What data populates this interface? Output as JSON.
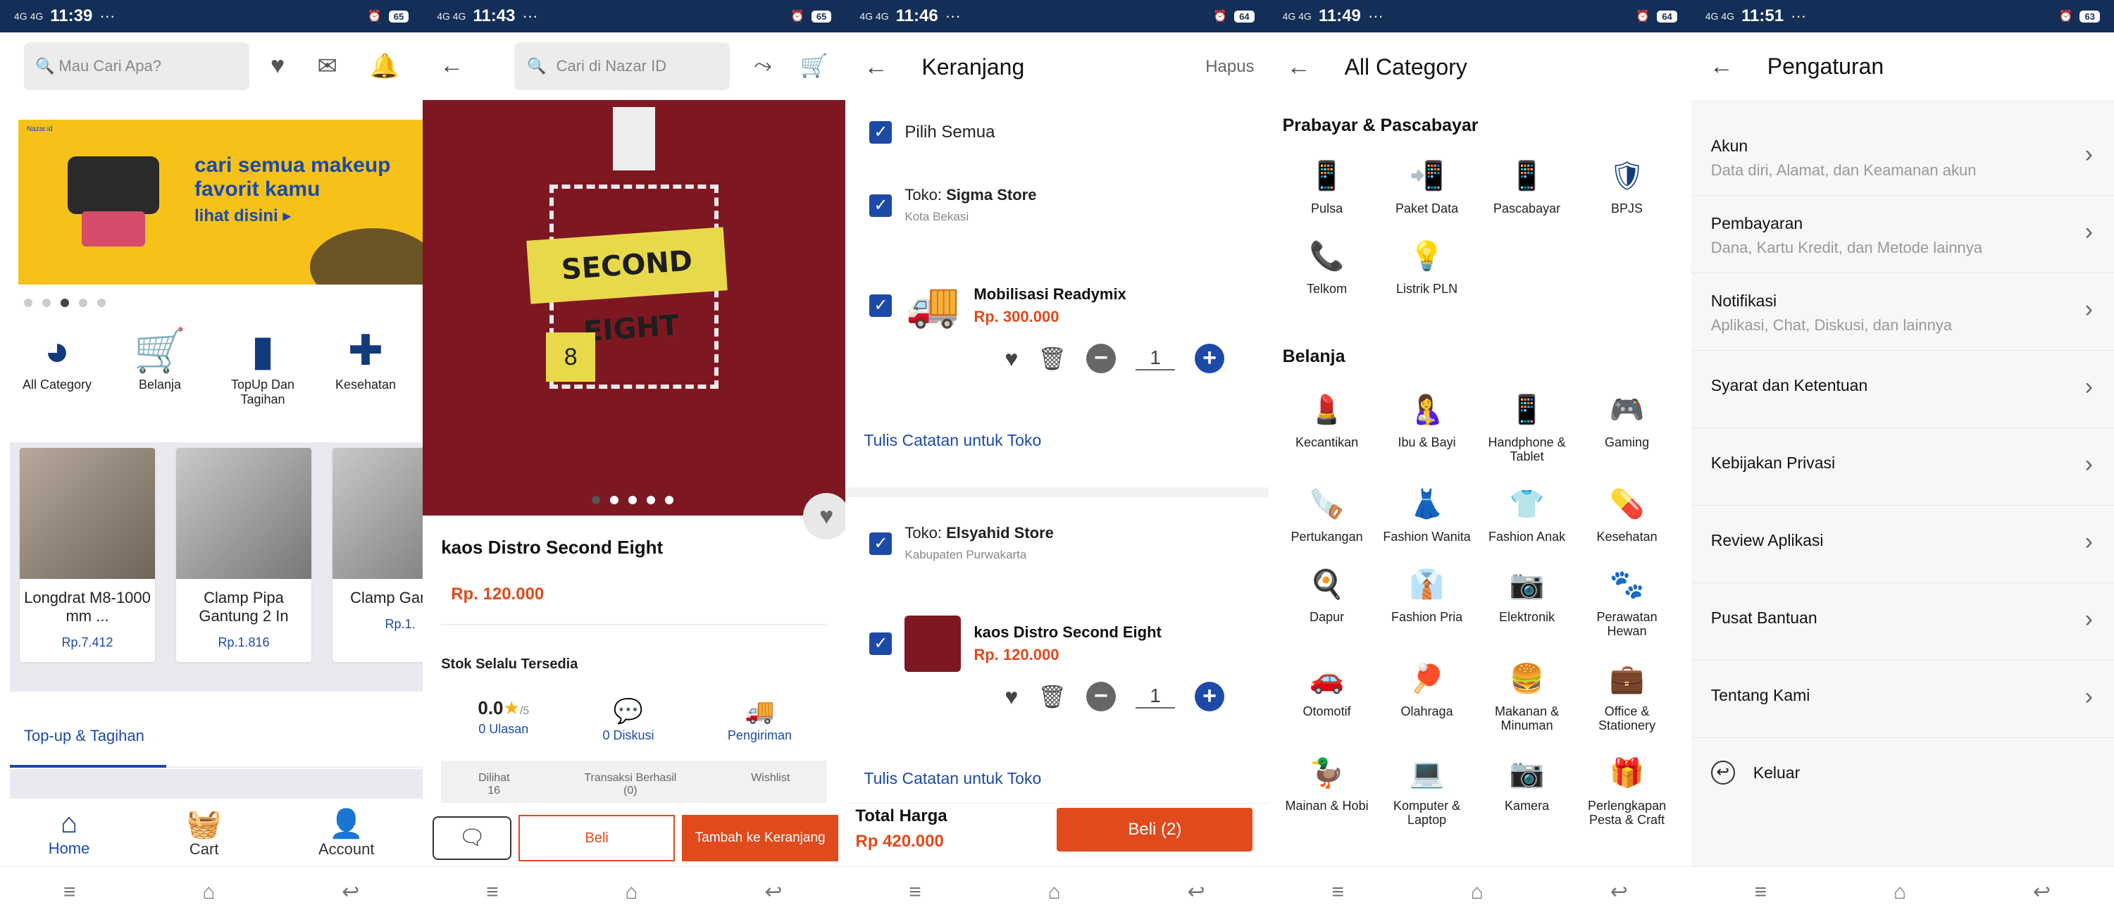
{
  "status_bars": [
    {
      "net": "4G 4G",
      "time": "11:39",
      "battery": "65"
    },
    {
      "net": "4G 4G",
      "time": "11:43",
      "battery": "65"
    },
    {
      "net": "4G 4G",
      "time": "11:46",
      "battery": "64"
    },
    {
      "net": "4G 4G",
      "time": "11:49",
      "battery": "64"
    },
    {
      "net": "4G 4G",
      "time": "11:51",
      "battery": "63"
    }
  ],
  "home": {
    "search_placeholder": "Mau Cari Apa?",
    "banner": {
      "brand": "Nazar.id",
      "line1": "cari semua makeup",
      "line2": "favorit kamu",
      "cta": "lihat disini ▸"
    },
    "categories": [
      {
        "label": "All Category",
        "icon": "pie-icon"
      },
      {
        "label": "Belanja",
        "icon": "cart-icon"
      },
      {
        "label": "TopUp Dan Tagihan",
        "icon": "phone-icon"
      },
      {
        "label": "Kesehatan",
        "icon": "medicine-icon"
      }
    ],
    "products": [
      {
        "name": "Longdrat M8-1000 mm ...",
        "price": "Rp.7.412"
      },
      {
        "name": "Clamp Pipa Gantung 2 In",
        "price": "Rp.1.816"
      },
      {
        "name": "Clamp Gantun",
        "price": "Rp.1."
      }
    ],
    "tab": "Top-up & Tagihan",
    "nav": {
      "home": "Home",
      "cart": "Cart",
      "account": "Account"
    }
  },
  "product": {
    "search_placeholder": "Cari di Nazar ID",
    "title": "kaos Distro Second Eight",
    "price": "Rp. 120.000",
    "stock": "Stok Selalu Tersedia",
    "print_text": "SECOND EIGHT",
    "print_number": "8",
    "rating": {
      "value": "0.0",
      "out_of": "/5",
      "reviews": "0 Ulasan"
    },
    "discussions": "0 Diskusi",
    "shipping": "Pengiriman",
    "meta": {
      "seen": "Dilihat",
      "seen_val": "16",
      "trx": "Transaksi Berhasil",
      "trx_val": "(0)",
      "wishlist": "Wishlist"
    },
    "buttons": {
      "buy": "Beli",
      "add": "Tambah ke Keranjang"
    }
  },
  "cart": {
    "title": "Keranjang",
    "delete": "Hapus",
    "select_all": "Pilih Semua",
    "store_prefix": "Toko: ",
    "stores": [
      {
        "name": "Sigma Store",
        "city": "Kota Bekasi",
        "item": "Mobilisasi Readymix",
        "price": "Rp. 300.000",
        "qty": "1"
      },
      {
        "name": "Elsyahid Store",
        "city": "Kabupaten Purwakarta",
        "item": "kaos Distro Second Eight",
        "price": "Rp. 120.000",
        "qty": "1"
      }
    ],
    "note": "Tulis Catatan untuk Toko",
    "total_label": "Total Harga",
    "total_value": "Rp 420.000",
    "buy": "Beli (2)"
  },
  "category": {
    "title": "All Category",
    "section1": "Prabayar & Pascabayar",
    "prepaid": [
      {
        "label": "Pulsa",
        "icon": "phone-icon"
      },
      {
        "label": "Paket Data",
        "icon": "phone-data-icon"
      },
      {
        "label": "Pascabayar",
        "icon": "phone-icon"
      },
      {
        "label": "BPJS",
        "icon": "shield-icon"
      },
      {
        "label": "Telkom",
        "icon": "telephone-icon"
      },
      {
        "label": "Listrik PLN",
        "icon": "bulb-icon"
      }
    ],
    "section2": "Belanja",
    "shop": [
      {
        "label": "Kecantikan",
        "icon": "beauty-icon"
      },
      {
        "label": "Ibu & Bayi",
        "icon": "mother-baby-icon"
      },
      {
        "label": "Handphone & Tablet",
        "icon": "handphone-icon"
      },
      {
        "label": "Gaming",
        "icon": "gamepad-icon"
      },
      {
        "label": "Pertukangan",
        "icon": "saw-icon"
      },
      {
        "label": "Fashion Wanita",
        "icon": "dress-icon"
      },
      {
        "label": "Fashion Anak",
        "icon": "kids-icon"
      },
      {
        "label": "Kesehatan",
        "icon": "medicine-icon"
      },
      {
        "label": "Dapur",
        "icon": "pan-icon"
      },
      {
        "label": "Fashion Pria",
        "icon": "shirt-icon"
      },
      {
        "label": "Elektronik",
        "icon": "camera-icon"
      },
      {
        "label": "Perawatan Hewan",
        "icon": "pet-bowl-icon"
      },
      {
        "label": "Otomotif",
        "icon": "car-icon"
      },
      {
        "label": "Olahraga",
        "icon": "racket-icon"
      },
      {
        "label": "Makanan & Minuman",
        "icon": "food-icon"
      },
      {
        "label": "Office & Stationery",
        "icon": "briefcase-icon"
      },
      {
        "label": "Mainan & Hobi",
        "icon": "toy-icon"
      },
      {
        "label": "Komputer & Laptop",
        "icon": "laptop-icon"
      },
      {
        "label": "Kamera",
        "icon": "camera-icon"
      },
      {
        "label": "Perlengkapan Pesta & Craft",
        "icon": "gift-icon"
      }
    ]
  },
  "settings": {
    "title": "Pengaturan",
    "items": [
      {
        "title": "Akun",
        "desc": "Data diri, Alamat, dan Keamanan akun"
      },
      {
        "title": "Pembayaran",
        "desc": "Dana, Kartu Kredit, dan Metode lainnya"
      },
      {
        "title": "Notifikasi",
        "desc": "Aplikasi, Chat, Diskusi, dan lainnya"
      },
      {
        "title": "Syarat dan Ketentuan",
        "desc": ""
      },
      {
        "title": "Kebijakan Privasi",
        "desc": ""
      },
      {
        "title": "Review Aplikasi",
        "desc": ""
      },
      {
        "title": "Pusat Bantuan",
        "desc": ""
      },
      {
        "title": "Tentang Kami",
        "desc": ""
      }
    ],
    "logout": "Keluar"
  }
}
